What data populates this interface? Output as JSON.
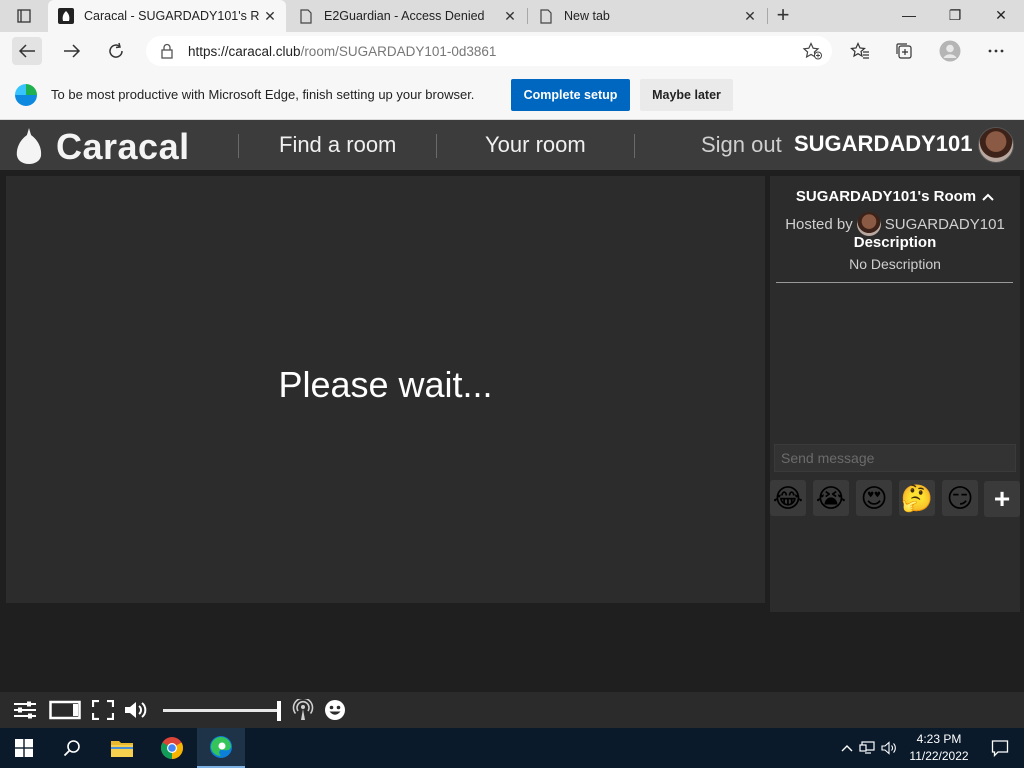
{
  "browser": {
    "tabs": [
      {
        "title": "Caracal - SUGARDADY101's Roo",
        "active": true
      },
      {
        "title": "E2Guardian - Access Denied",
        "active": false
      },
      {
        "title": "New tab",
        "active": false
      }
    ],
    "close_glyph": "✕",
    "new_tab_glyph": "+",
    "window_controls": {
      "minimize": "—",
      "restore": "❐",
      "close": "✕"
    },
    "url_host": "https://caracal.club",
    "url_path": "/room/SUGARDADY101-0d3861",
    "infobar": {
      "message": "To be most productive with Microsoft Edge, finish setting up your browser.",
      "primary_label": "Complete setup",
      "secondary_label": "Maybe later"
    }
  },
  "site": {
    "logo_text": "Caracal",
    "nav": {
      "find_room": "Find a room",
      "your_room": "Your room"
    },
    "sign_out": "Sign out",
    "username": "SUGARDADY101"
  },
  "video": {
    "status": "Please wait..."
  },
  "room": {
    "title": "SUGARDADY101's Room",
    "hosted_by_label": "Hosted by",
    "host_name": "SUGARDADY101",
    "description_heading": "Description",
    "description_value": "No Description"
  },
  "chat": {
    "placeholder": "Send message",
    "emojis": [
      "😂",
      "😭",
      "😍",
      "🤔",
      "😏"
    ],
    "add_glyph": "+"
  },
  "player": {
    "volume_level": 1.0
  },
  "taskbar": {
    "time": "4:23 PM",
    "date": "11/22/2022"
  },
  "colors": {
    "accent_button": "#0067c0",
    "site_header": "#3c3c3c",
    "panel": "#2c2c2c"
  }
}
